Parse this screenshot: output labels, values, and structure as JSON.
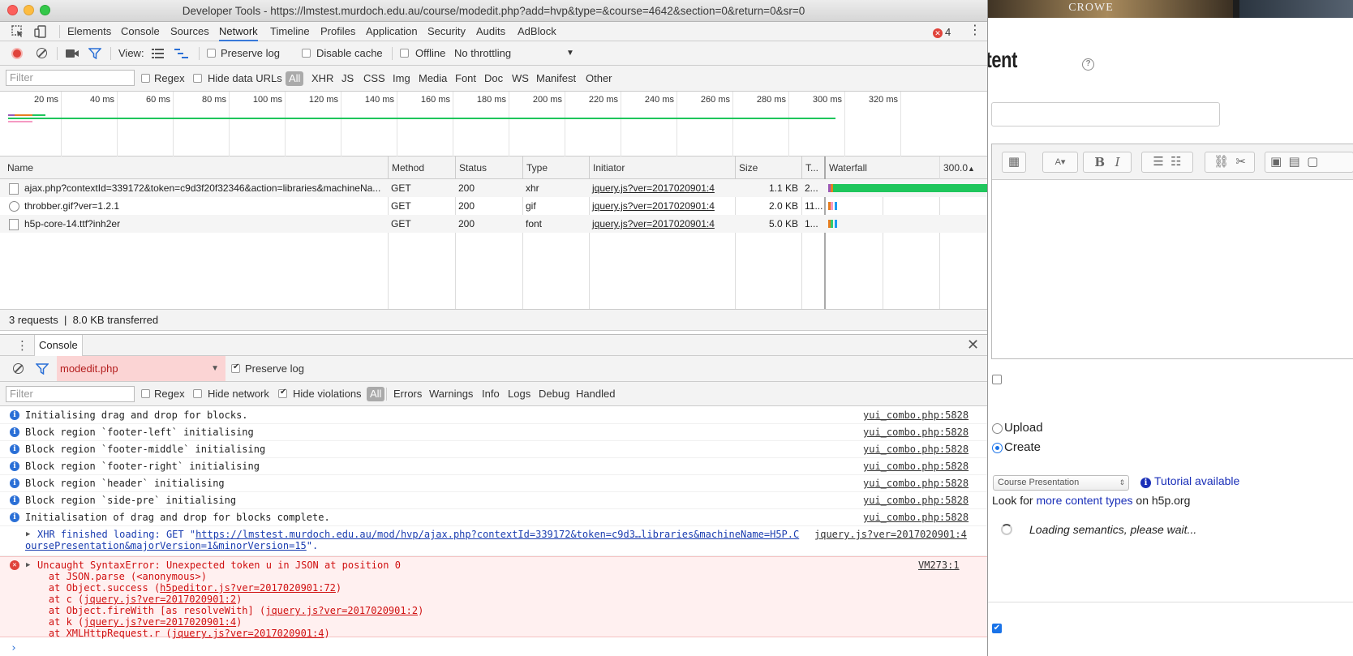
{
  "window": {
    "title": "Developer Tools - https://lmstest.murdoch.edu.au/course/modedit.php?add=hvp&type=&course=4642&section=0&return=0&sr=0"
  },
  "tabs": [
    "Elements",
    "Console",
    "Sources",
    "Network",
    "Timeline",
    "Profiles",
    "Application",
    "Security",
    "Audits",
    "AdBlock"
  ],
  "active_tab": "Network",
  "error_count": "4",
  "network_toolbar": {
    "view_label": "View:",
    "preserve_log": "Preserve log",
    "disable_cache": "Disable cache",
    "offline": "Offline",
    "throttling": "No throttling"
  },
  "network_filter": {
    "placeholder": "Filter",
    "regex": "Regex",
    "hide_data_urls": "Hide data URLs",
    "types": [
      "All",
      "XHR",
      "JS",
      "CSS",
      "Img",
      "Media",
      "Font",
      "Doc",
      "WS",
      "Manifest",
      "Other"
    ]
  },
  "overview_ticks": [
    "20 ms",
    "40 ms",
    "60 ms",
    "80 ms",
    "100 ms",
    "120 ms",
    "140 ms",
    "160 ms",
    "180 ms",
    "200 ms",
    "220 ms",
    "240 ms",
    "260 ms",
    "280 ms",
    "300 ms",
    "320 ms"
  ],
  "table": {
    "columns": [
      "Name",
      "Method",
      "Status",
      "Type",
      "Initiator",
      "Size",
      "T...",
      "Waterfall",
      "300.0"
    ],
    "rows": [
      {
        "name": "ajax.php?contextId=339172&token=c9d3f20f32346&action=libraries&machineNa...",
        "method": "GET",
        "status": "200",
        "type": "xhr",
        "initiator": "jquery.js?ver=2017020901:4",
        "size": "1.1 KB",
        "time": "2..."
      },
      {
        "name": "throbber.gif?ver=1.2.1",
        "method": "GET",
        "status": "200",
        "type": "gif",
        "initiator": "jquery.js?ver=2017020901:4",
        "size": "2.0 KB",
        "time": "11..."
      },
      {
        "name": "h5p-core-14.ttf?inh2er",
        "method": "GET",
        "status": "200",
        "type": "font",
        "initiator": "jquery.js?ver=2017020901:4",
        "size": "5.0 KB",
        "time": "1..."
      }
    ],
    "summary_requests": "3 requests",
    "summary_sep": "|",
    "summary_transferred": "8.0 KB transferred"
  },
  "drawer": {
    "tab": "Console",
    "context": "modedit.php",
    "preserve_log": "Preserve log",
    "filter_placeholder": "Filter",
    "regex": "Regex",
    "hide_network": "Hide network",
    "hide_violations": "Hide violations",
    "levels": [
      "All",
      "Errors",
      "Warnings",
      "Info",
      "Logs",
      "Debug",
      "Handled"
    ]
  },
  "console": {
    "messages": [
      {
        "text": "Initialising drag and drop for blocks.",
        "source": "yui_combo.php:5828"
      },
      {
        "text": "Block region `footer-left` initialising",
        "source": "yui_combo.php:5828"
      },
      {
        "text": "Block region `footer-middle` initialising",
        "source": "yui_combo.php:5828"
      },
      {
        "text": "Block region `footer-right` initialising",
        "source": "yui_combo.php:5828"
      },
      {
        "text": "Block region `header` initialising",
        "source": "yui_combo.php:5828"
      },
      {
        "text": "Block region `side-pre` initialising",
        "source": "yui_combo.php:5828"
      },
      {
        "text": "Initialisation of drag and drop for blocks complete.",
        "source": "yui_combo.php:5828"
      }
    ],
    "xhr": {
      "prefix": "XHR finished loading: GET \"",
      "url_line1": "https://lmstest.murdoch.edu.au/mod/hvp/ajax.php?contextId=339172&token=c9d3…libraries&machineName=H5P.C",
      "url_line2": "oursePresentation&majorVersion=1&minorVersion=15",
      "suffix": "\".",
      "source": "jquery.js?ver=2017020901:4"
    },
    "error": {
      "title": "Uncaught SyntaxError: Unexpected token u in JSON at position 0",
      "source": "VM273:1",
      "stack": [
        {
          "pre": "    at JSON.parse (<anonymous>)",
          "link": "",
          "post": ""
        },
        {
          "pre": "    at Object.success (",
          "link": "h5peditor.js?ver=2017020901:72",
          "post": ")"
        },
        {
          "pre": "    at c (",
          "link": "jquery.js?ver=2017020901:2",
          "post": ")"
        },
        {
          "pre": "    at Object.fireWith [as resolveWith] (",
          "link": "jquery.js?ver=2017020901:2",
          "post": ")"
        },
        {
          "pre": "    at k (",
          "link": "jquery.js?ver=2017020901:4",
          "post": ")"
        },
        {
          "pre": "    at XMLHttpRequest.r (",
          "link": "jquery.js?ver=2017020901:4",
          "post": ")"
        }
      ]
    },
    "prompt": "›"
  },
  "background_page": {
    "banner_text": "CROWE",
    "heading": "ve Content",
    "help": "?",
    "upload_label": "Upload",
    "create_label": "Create",
    "select_value": "Course Presentation",
    "tutorial_link": "Tutorial available",
    "look_prefix": "Look for ",
    "look_link": "more content types",
    "look_suffix": " on h5p.org",
    "loading": "Loading semantics, please wait..."
  },
  "colors": {
    "accent": "#3879d9",
    "error": "#e0433b",
    "waterfall_green": "#1fc65c",
    "waterfall_blue": "#1d9bf0"
  }
}
